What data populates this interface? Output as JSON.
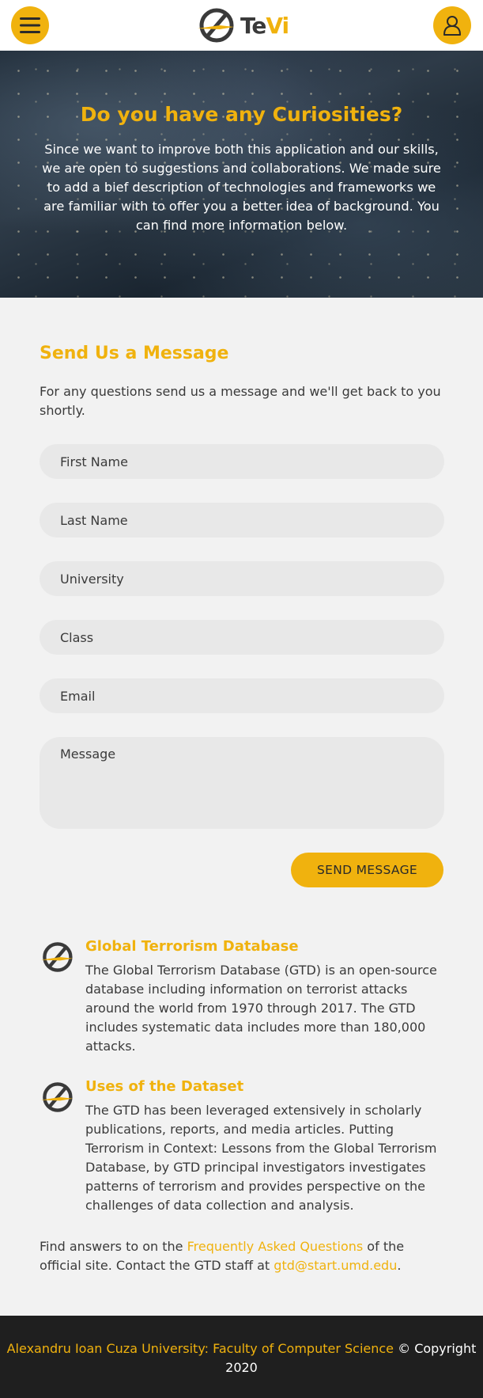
{
  "header": {
    "logo_text_a": "Te",
    "logo_text_b": "Vi",
    "menu_icon": "hamburger-icon",
    "user_icon": "user-icon"
  },
  "hero": {
    "title": "Do you have any Curiosities?",
    "text": "Since we want to improve both this application and our skills, we are open to suggestions and collaborations. We made sure to add a bief description of technologies and frameworks we are familiar with to offer you a better idea of background. You can find more information below."
  },
  "contact": {
    "title": "Send Us a Message",
    "intro": "For any questions send us a message and we'll get back to you shortly.",
    "fields": {
      "first_name": "First Name",
      "last_name": "Last Name",
      "university": "University",
      "class": "Class",
      "email": "Email",
      "message": "Message"
    },
    "send_label": "SEND MESSAGE"
  },
  "info": [
    {
      "title": "Global Terrorism Database",
      "text": "The Global Terrorism Database (GTD) is an open-source database including information on terrorist attacks around the world from 1970 through 2017. The GTD includes systematic data includes more than 180,000 attacks."
    },
    {
      "title": "Uses of the Dataset",
      "text": "The GTD has been leveraged extensively in scholarly publications, reports, and media articles. Putting Terrorism in Context: Lessons from the Global Terrorism Database, by GTD principal investigators investigates patterns of terrorism and provides perspective on the challenges of data collection and analysis."
    }
  ],
  "faq": {
    "prefix": "Find answers to on the ",
    "link": "Frequently Asked Questions",
    "middle": " of the official site. Contact the GTD staff at ",
    "email": "gtd@start.umd.edu",
    "suffix": "."
  },
  "footer": {
    "faculty": "Alexandru Ioan Cuza University: Faculty of Computer Science",
    "copyright": " © Copyright 2020"
  },
  "colors": {
    "accent": "#f0b20e",
    "footer_bg": "#1f1f1f",
    "page_bg": "#f2f2f2"
  }
}
